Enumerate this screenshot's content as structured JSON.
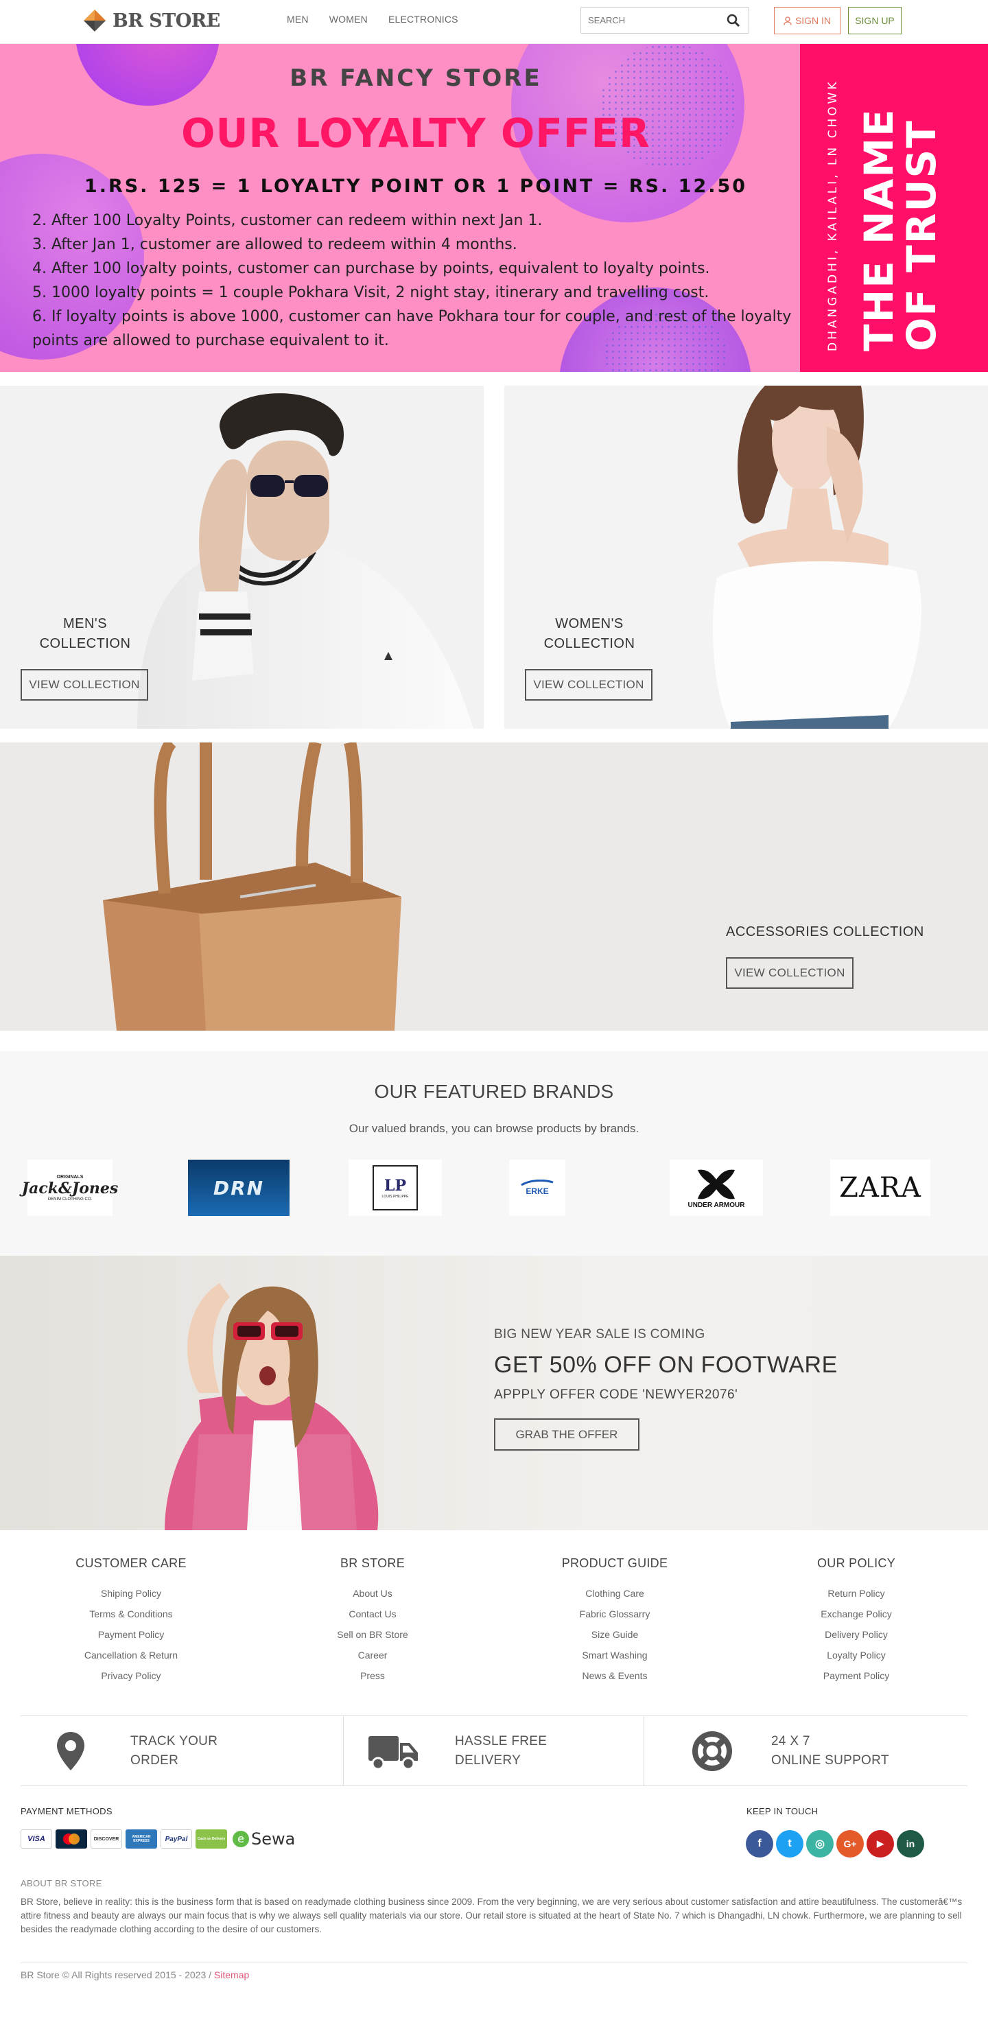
{
  "header": {
    "logo_text": "BR STORE",
    "nav": [
      "MEN",
      "WOMEN",
      "ELECTRONICS"
    ],
    "search_placeholder": "SEARCH",
    "signin_label": "SIGN IN",
    "signup_label": "SIGN UP"
  },
  "hero": {
    "store_name": "BR FANCY STORE",
    "offer_title": "OUR LOYALTY OFFER",
    "rate_line": "1.RS. 125 = 1 LOYALTY POINT OR 1 POINT = RS. 12.50",
    "rules": [
      "2. After 100 Loyalty Points, customer can redeem within next Jan 1.",
      "3. After Jan 1, customer are allowed to redeem within 4 months.",
      "4. After 100 loyalty points, customer can purchase by points, equivalent to loyalty points.",
      "5. 1000 loyalty points = 1 couple Pokhara Visit, 2 night stay, itinerary and travelling cost.",
      "6. If loyalty points is above 1000, customer can have Pokhara tour for couple, and rest of the loyalty points are allowed to purchase equivalent to it."
    ],
    "side_address": "DHANGADHI, KAILALI, LN CHOWK",
    "side_tagline_1": "THE NAME",
    "side_tagline_2": "OF TRUST",
    "accent_color": "#ff0f67",
    "bg_color": "#fe8fc4"
  },
  "collections": {
    "men_title_1": "MEN'S",
    "men_title_2": "COLLECTION",
    "women_title_1": "WOMEN'S",
    "women_title_2": "COLLECTION",
    "accessories_title": "ACCESSORIES COLLECTION",
    "view_label": "VIEW COLLECTION"
  },
  "brands": {
    "heading": "OUR FEATURED BRANDS",
    "subheading": "Our valued brands, you can browse products by brands.",
    "items": [
      {
        "name": "Jack&Jones",
        "top": "ORIGINALS",
        "bottom": "DENIM CLOTHING CO."
      },
      {
        "name": "DRN"
      },
      {
        "name": "LP",
        "bottom": "LOUIS PHILIPPE"
      },
      {
        "name": "ERKE"
      },
      {
        "name": "UNDER ARMOUR"
      },
      {
        "name": "ZARA"
      }
    ]
  },
  "sale": {
    "line1": "BIG NEW YEAR SALE IS COMING",
    "line2": "GET 50% OFF ON FOOTWARE",
    "line3": "APPPLY OFFER CODE 'NEWYER2076'",
    "button": "GRAB THE OFFER"
  },
  "footer": {
    "columns": [
      {
        "title": "CUSTOMER CARE",
        "links": [
          "Shiping Policy",
          "Terms & Conditions",
          "Payment Policy",
          "Cancellation & Return",
          "Privacy Policy"
        ]
      },
      {
        "title": "BR STORE",
        "links": [
          "About Us",
          "Contact Us",
          "Sell on BR Store",
          "Career",
          "Press"
        ]
      },
      {
        "title": "PRODUCT GUIDE",
        "links": [
          "Clothing Care",
          "Fabric Glossarry",
          "Size Guide",
          "Smart Washing",
          "News & Events"
        ]
      },
      {
        "title": "OUR POLICY",
        "links": [
          "Return Policy",
          "Exchange Policy",
          "Delivery Policy",
          "Loyalty Policy",
          "Payment Policy"
        ]
      }
    ],
    "features": [
      {
        "line1": "TRACK YOUR",
        "line2": "ORDER",
        "icon": "map-pin-icon"
      },
      {
        "line1": "HASSLE FREE",
        "line2": "DELIVERY",
        "icon": "truck-icon"
      },
      {
        "line1": "24 X 7",
        "line2": "ONLINE SUPPORT",
        "icon": "lifebuoy-icon"
      }
    ],
    "payment_heading": "PAYMENT METHODS",
    "payment_cards": [
      "VISA",
      "MasterCard",
      "DISCOVER",
      "AMERICAN EXPRESS",
      "PayPal",
      "Cash on Delivery"
    ],
    "sewa": "Sewa",
    "keep_in_touch": "KEEP IN TOUCH",
    "social": [
      {
        "name": "facebook",
        "glyph": "f",
        "color": "#3b5998"
      },
      {
        "name": "twitter",
        "glyph": "t",
        "color": "#1da1f2"
      },
      {
        "name": "instagram",
        "glyph": "◎",
        "color": "#3cb4a4"
      },
      {
        "name": "google-plus",
        "glyph": "G+",
        "color": "#e45b29"
      },
      {
        "name": "youtube",
        "glyph": "▶",
        "color": "#cc1f1f"
      },
      {
        "name": "linkedin",
        "glyph": "in",
        "color": "#1e5a45"
      }
    ],
    "about_heading": "ABOUT BR STORE",
    "about_text": "BR Store, believe in reality: this is the business form that is based on readymade clothing business since 2009. From the very beginning, we are very serious about customer satisfaction and attire beautifulness. The customerâ€™s attire fitness and beauty are always our main focus that is why we always sell quality materials via our store. Our retail store is situated at the heart of State No. 7 which is Dhangadhi, LN chowk. Furthermore, we are planning to sell besides the readymade clothing according to the desire of our customers.",
    "copyright": "BR Store © All Rights reserved 2015 - 2023 / ",
    "sitemap": "Sitemap"
  }
}
